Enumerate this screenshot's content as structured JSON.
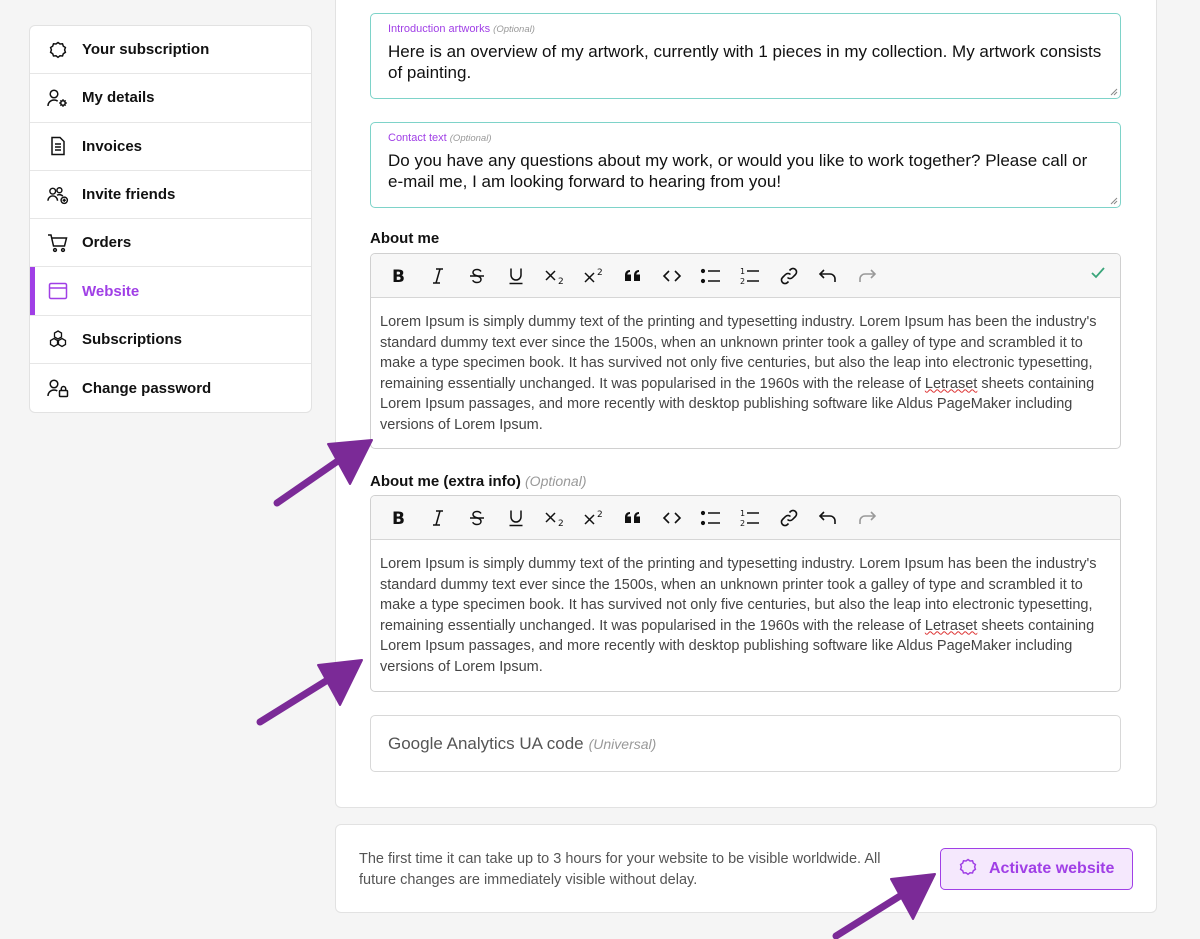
{
  "sidebar": {
    "items": [
      {
        "label": "Your subscription",
        "icon": "badge-icon",
        "active": false
      },
      {
        "label": "My details",
        "icon": "user-gear-icon",
        "active": false
      },
      {
        "label": "Invoices",
        "icon": "document-icon",
        "active": false
      },
      {
        "label": "Invite friends",
        "icon": "users-plus-icon",
        "active": false
      },
      {
        "label": "Orders",
        "icon": "cart-icon",
        "active": false
      },
      {
        "label": "Website",
        "icon": "browser-window-icon",
        "active": true
      },
      {
        "label": "Subscriptions",
        "icon": "cubes-icon",
        "active": false
      },
      {
        "label": "Change password",
        "icon": "user-lock-icon",
        "active": false
      }
    ]
  },
  "form": {
    "intro": {
      "label": "Introduction artworks",
      "optional": "(Optional)",
      "value": "Here is an overview of my artwork, currently with 1 pieces in my collection. My artwork consists of painting."
    },
    "contact": {
      "label": "Contact text",
      "optional": "(Optional)",
      "value": "Do you have any questions about my work, or would you like to work together? Please call or e-mail me, I am looking forward to hearing from you!"
    },
    "about": {
      "label": "About me",
      "body_before": "Lorem Ipsum is simply dummy text of the printing and typesetting industry. Lorem Ipsum has been the industry's standard dummy text ever since the 1500s, when an unknown printer took a galley of type and scrambled it to make a type specimen book. It has survived not only five centuries, but also the leap into electronic typesetting, remaining essentially unchanged. It was popularised in the 1960s with the release of ",
      "body_spell": "Letraset",
      "body_after": " sheets containing Lorem Ipsum passages, and more recently with desktop publishing software like Aldus PageMaker including versions of Lorem Ipsum."
    },
    "about_extra": {
      "label": "About me (extra info)",
      "optional": "(Optional)",
      "body_before": "Lorem Ipsum is simply dummy text of the printing and typesetting industry. Lorem Ipsum has been the industry's standard dummy text ever since the 1500s, when an unknown printer took a galley of type and scrambled it to make a type specimen book. It has survived not only five centuries, but also the leap into electronic typesetting, remaining essentially unchanged. It was popularised in the 1960s with the release of ",
      "body_spell": "Letraset",
      "body_after": " sheets containing Lorem Ipsum passages, and more recently with desktop publishing software like Aldus PageMaker including versions of Lorem Ipsum."
    },
    "toolbar": [
      "bold-icon",
      "italic-icon",
      "strikethrough-icon",
      "underline-icon",
      "subscript-icon",
      "superscript-icon",
      "quote-icon",
      "code-icon",
      "bullet-list-icon",
      "numbered-list-icon",
      "link-icon",
      "undo-icon",
      "redo-icon"
    ],
    "ga": {
      "placeholder": "Google Analytics UA code",
      "optional": "(Universal)"
    }
  },
  "footer": {
    "note": "The first time it can take up to 3 hours for your website to be visible worldwide. All future changes are immediately visible without delay.",
    "activate_label": "Activate website"
  },
  "colors": {
    "accent": "#a03fe6",
    "field_border": "#7ed3c9",
    "check": "#3aa57a",
    "arrow": "#7b2a97"
  }
}
